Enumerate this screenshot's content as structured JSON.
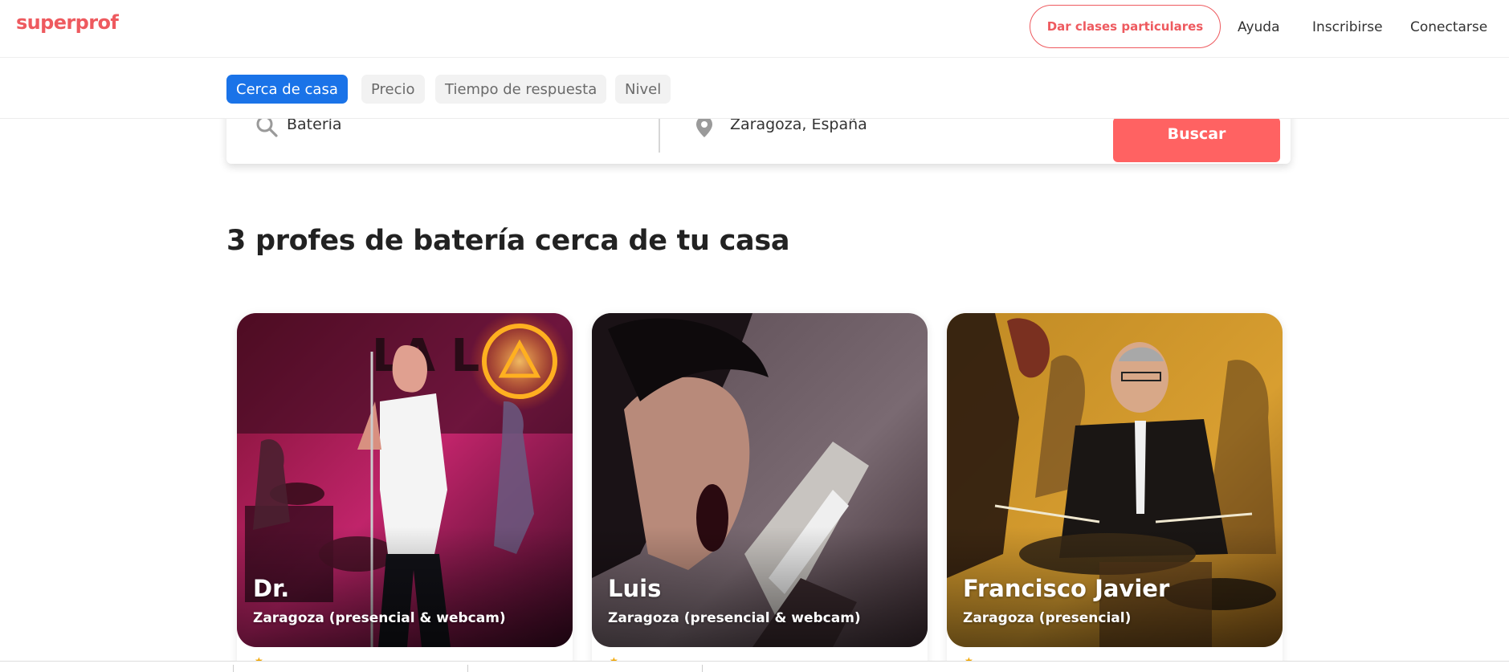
{
  "header": {
    "logo": "superprof",
    "teach_button": "Dar clases particulares",
    "links": [
      "Ayuda",
      "Inscribirse",
      "Conectarse"
    ]
  },
  "filters": [
    {
      "label": "Cerca de casa",
      "active": true
    },
    {
      "label": "Precio",
      "active": false
    },
    {
      "label": "Tiempo de respuesta",
      "active": false
    },
    {
      "label": "Nivel",
      "active": false
    }
  ],
  "search": {
    "subject_value": "Batería",
    "location_value": "Zaragoza, España",
    "button_label": "Buscar"
  },
  "results": {
    "title": "3 profes de batería cerca de tu casa"
  },
  "teachers": [
    {
      "name": "Dr.",
      "location": "Zaragoza (presencial & webcam)"
    },
    {
      "name": "Luis",
      "location": "Zaragoza (presencial & webcam)"
    },
    {
      "name": "Francisco Javier",
      "location": "Zaragoza (presencial)"
    }
  ],
  "colors": {
    "brand": "#ee5a5f",
    "active_chip": "#1a73e8",
    "search_button": "#ff6262"
  }
}
